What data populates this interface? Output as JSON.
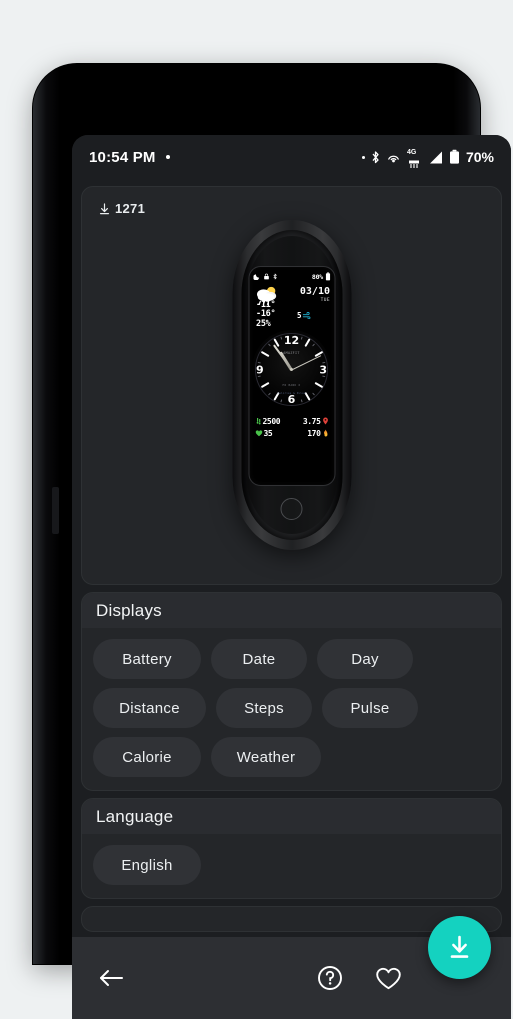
{
  "status_bar": {
    "time": "10:54 PM",
    "notification_dot": "dot-icon",
    "icons": [
      "small-dot-icon",
      "bluetooth-icon",
      "hotspot-icon",
      "network-4g-icon",
      "signal-icon",
      "battery-icon"
    ],
    "network_label": "4G",
    "battery_percent": "70%"
  },
  "preview": {
    "download_icon": "download-arrow-icon",
    "download_count": "1271"
  },
  "watch_face": {
    "status_icons": [
      "moon-icon",
      "lock-icon",
      "bluetooth-icon"
    ],
    "battery_percent": "80%",
    "weather_icon": "sun-cloud-rain-icon",
    "date": "03/10",
    "weekday": "TUE",
    "temp_high": "-11°",
    "temp_low": "-16°",
    "humidity": "25%",
    "wind_value": "5",
    "wind_icon": "wind-icon",
    "dial_numerals": [
      "12",
      "3",
      "6",
      "9"
    ],
    "brand_top": "AMAZFIT",
    "brand_mid": "MI BAND 6",
    "brand_bottom": "Calories & Pulse",
    "clock_time": "10:54",
    "stats": [
      {
        "icon": "steps-icon",
        "icon_color": "#49c24a",
        "value": "2500",
        "align": "left"
      },
      {
        "icon": "location-pin-icon",
        "icon_color": "#e0423a",
        "value": "3.75",
        "align": "right"
      },
      {
        "icon": "heart-icon",
        "icon_color": "#49c24a",
        "value": "35",
        "align": "left"
      },
      {
        "icon": "flame-icon",
        "icon_color": "#f0932b",
        "value": "170",
        "align": "right"
      }
    ]
  },
  "sections": [
    {
      "id": "displays",
      "title": "Displays",
      "rows": [
        [
          {
            "label": "Battery",
            "key": "battery"
          },
          {
            "label": "Date",
            "key": "date"
          },
          {
            "label": "Day",
            "key": "day"
          }
        ],
        [
          {
            "label": "Distance",
            "key": "distance"
          },
          {
            "label": "Steps",
            "key": "steps"
          },
          {
            "label": "Pulse",
            "key": "pulse"
          }
        ],
        [
          {
            "label": "Calorie",
            "key": "calorie"
          },
          {
            "label": "Weather",
            "key": "weather"
          }
        ]
      ]
    },
    {
      "id": "language",
      "title": "Language",
      "rows": [
        [
          {
            "label": "English",
            "key": "english"
          }
        ]
      ]
    }
  ],
  "bottom_bar": {
    "back_icon": "back-arrow-icon",
    "help_icon": "help-circle-icon",
    "favorite_icon": "heart-outline-icon",
    "fab_icon": "download-icon"
  },
  "colors": {
    "accent": "#14d2c0",
    "screen_bg": "#1c1e21",
    "card_bg": "#242629",
    "section_head_bg": "#2a2c30",
    "chip_bg": "#303236",
    "bottom_bar_bg": "#2d2f33"
  }
}
